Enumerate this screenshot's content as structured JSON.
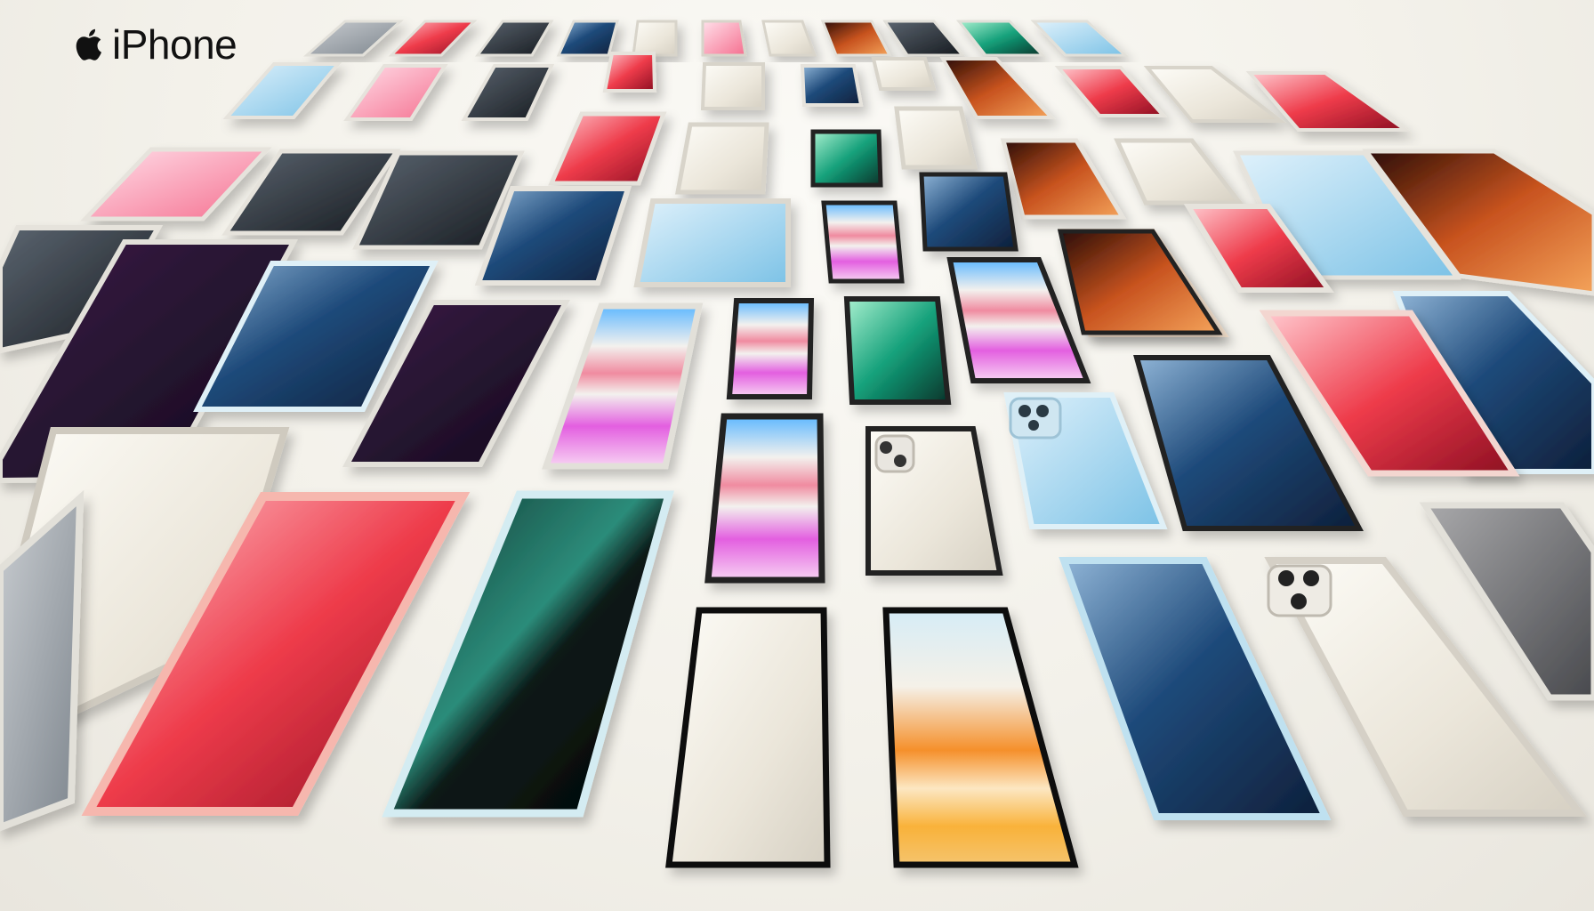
{
  "brand": {
    "name": "iPhone",
    "logo_icon": "apple-logo-icon",
    "text_color": "#111111"
  },
  "scene": {
    "background_color": "#f3f1ea",
    "palette": [
      "#1f3f66",
      "#3a78b5",
      "#e23b3b",
      "#f26f7a",
      "#16a37a",
      "#f5f3ee",
      "#e9455a",
      "#d88bf0",
      "#f6a93b",
      "#2a2a2a",
      "#c9e3f0",
      "#b25a35"
    ]
  }
}
